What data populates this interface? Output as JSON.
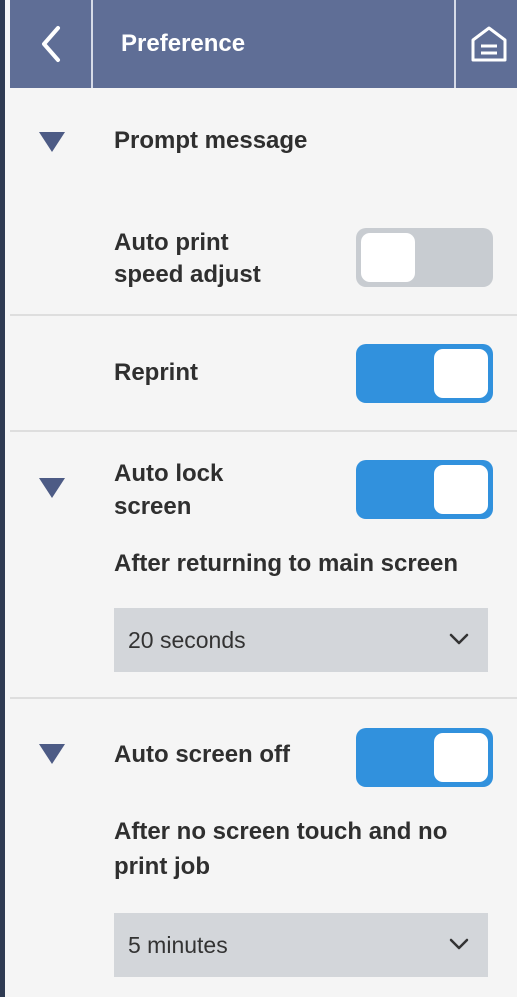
{
  "header": {
    "title": "Preference"
  },
  "sections": {
    "prompt_message": {
      "title": "Prompt message",
      "auto_print_speed_adjust": {
        "label_line1": "Auto print",
        "label_line2": "speed adjust",
        "state": "off"
      }
    },
    "reprint": {
      "label": "Reprint",
      "state": "on"
    },
    "auto_lock_screen": {
      "label_line1": "Auto lock",
      "label_line2": "screen",
      "state": "on",
      "description": "After returning to main screen",
      "selected": "20 seconds"
    },
    "auto_screen_off": {
      "label": "Auto screen off",
      "state": "on",
      "description_line1": "After no screen touch and no",
      "description_line2": "print job",
      "selected": "5 minutes"
    }
  },
  "icons": {
    "back": "chevron-left-icon",
    "home": "home-icon",
    "expand": "caret-down-icon",
    "dropdown": "chevron-down-icon"
  },
  "colors": {
    "header_bg": "#5f6e96",
    "toggle_on": "#3191dd",
    "toggle_off": "#c8ccd1",
    "caret": "#4d5b85"
  }
}
